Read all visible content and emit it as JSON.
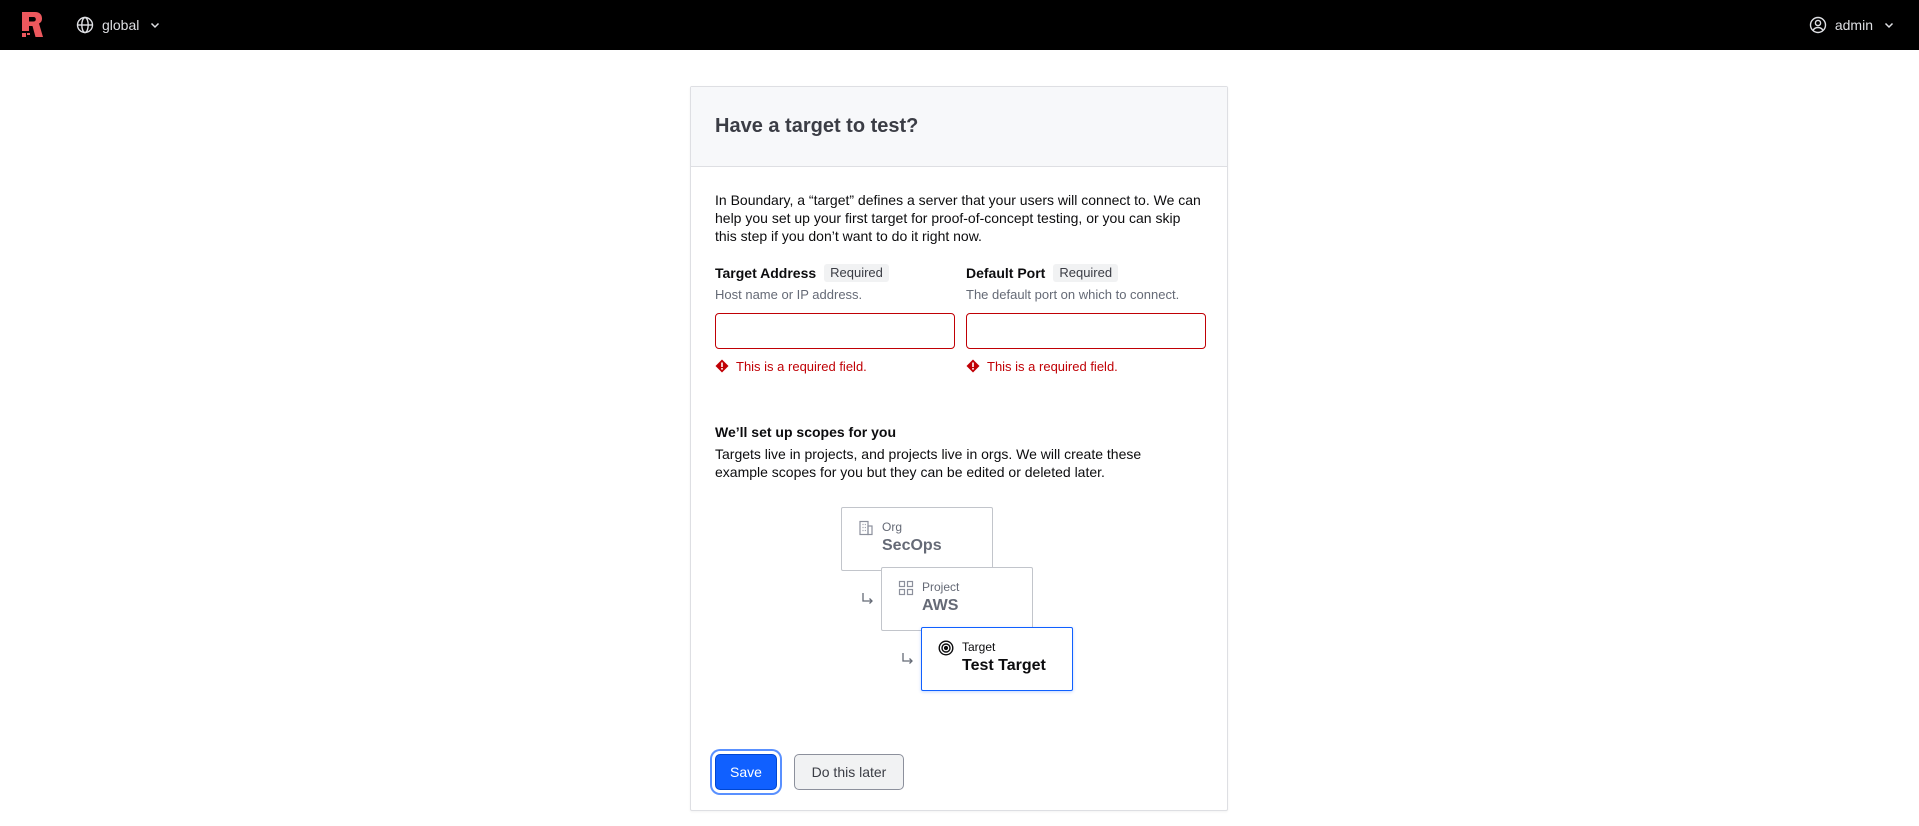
{
  "header": {
    "logo": "boundary-logo",
    "scope": "global",
    "user": "admin"
  },
  "card": {
    "title": "Have a target to test?",
    "intro": "In Boundary, a “target” defines a server that your users will connect to. We can help you set up your first target for proof-of-concept testing, or you can skip this step if you don’t want to do it right now.",
    "fields": {
      "address": {
        "label": "Target Address",
        "badge": "Required",
        "helper": "Host name or IP address.",
        "value": "",
        "error": "This is a required field."
      },
      "port": {
        "label": "Default Port",
        "badge": "Required",
        "helper": "The default port on which to connect.",
        "value": "",
        "error": "This is a required field."
      }
    },
    "scopes": {
      "title": "We’ll set up scopes for you",
      "description": "Targets live in projects, and projects live in orgs. We will create these example scopes for you but they can be edited or deleted later.",
      "org": {
        "type": "Org",
        "name": "SecOps"
      },
      "project": {
        "type": "Project",
        "name": "AWS"
      },
      "target": {
        "type": "Target",
        "name": "Test Target"
      }
    },
    "actions": {
      "save": "Save",
      "later": "Do this later"
    }
  },
  "colors": {
    "accent": "#1060ff",
    "error": "#c00005",
    "brand": "#ec585d"
  }
}
